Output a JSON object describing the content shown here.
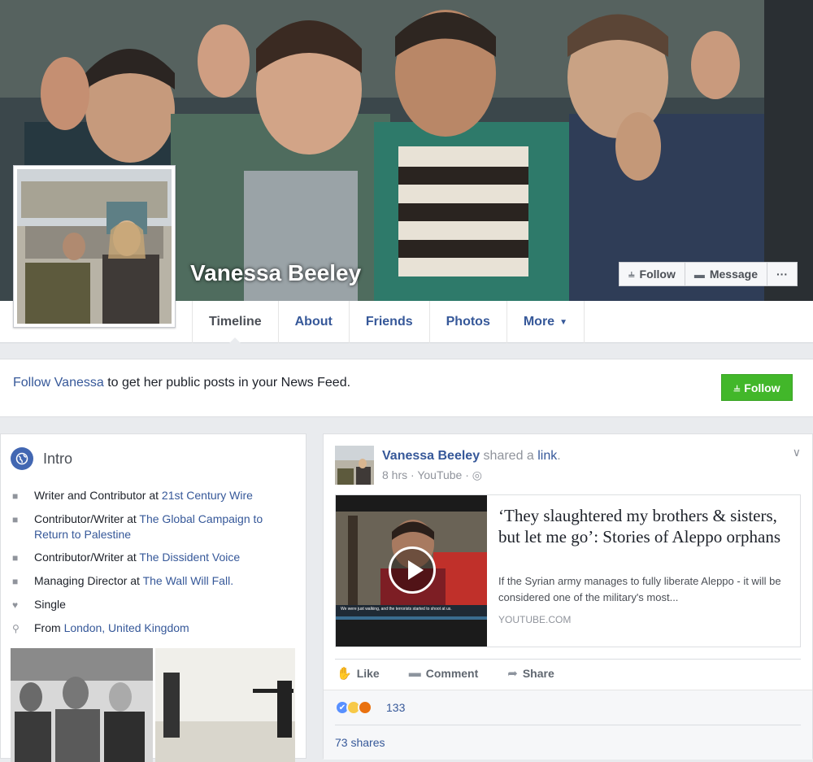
{
  "profile": {
    "name": "Vanessa Beeley"
  },
  "cover_actions": {
    "follow_label": "Follow",
    "message_label": "Message",
    "more_label": "···"
  },
  "tabs": [
    {
      "label": "Timeline",
      "active": true
    },
    {
      "label": "About"
    },
    {
      "label": "Friends"
    },
    {
      "label": "Photos"
    },
    {
      "label": "More"
    }
  ],
  "follow_banner": {
    "link_text": "Follow Vanessa",
    "rest_text": " to get her public posts in your News Feed.",
    "button_label": "Follow"
  },
  "intro": {
    "title": "Intro",
    "items": [
      {
        "icon": "briefcase-icon",
        "prefix": "Writer and Contributor at ",
        "link": "21st Century Wire"
      },
      {
        "icon": "briefcase-icon",
        "prefix": "Contributor/Writer at ",
        "link": "The Global Campaign to Return to Palestine"
      },
      {
        "icon": "briefcase-icon",
        "prefix": "Contributor/Writer at ",
        "link": "The Dissident Voice"
      },
      {
        "icon": "briefcase-icon",
        "prefix": "Managing Director at ",
        "link": "The Wall Will Fall."
      },
      {
        "icon": "heart-icon",
        "prefix": "Single",
        "link": ""
      },
      {
        "icon": "location-pin-icon",
        "prefix": "From ",
        "link": "London, United Kingdom"
      }
    ]
  },
  "post": {
    "author": "Vanessa Beeley",
    "shared_text": " shared a ",
    "link_word": "link",
    "after_link": ".",
    "time": "8 hrs",
    "source": "YouTube",
    "link": {
      "title": "‘They slaughtered my brothers & sisters, but let me go’: Stories of Aleppo orphans",
      "description": "If the Syrian army manages to fully liberate Aleppo - it will be considered one of the military's most...",
      "domain": "YOUTUBE.COM",
      "thumb_caption": "We were just walking, and the terrorists started to shoot at us."
    },
    "actions": {
      "like": "Like",
      "comment": "Comment",
      "share": "Share"
    },
    "reactions": {
      "types": [
        "like",
        "sad",
        "angry"
      ],
      "count": "133"
    },
    "shares": "73 shares"
  },
  "colors": {
    "facebook_blue": "#365899",
    "follow_green": "#42b72a",
    "page_bg": "#e9ebee"
  }
}
